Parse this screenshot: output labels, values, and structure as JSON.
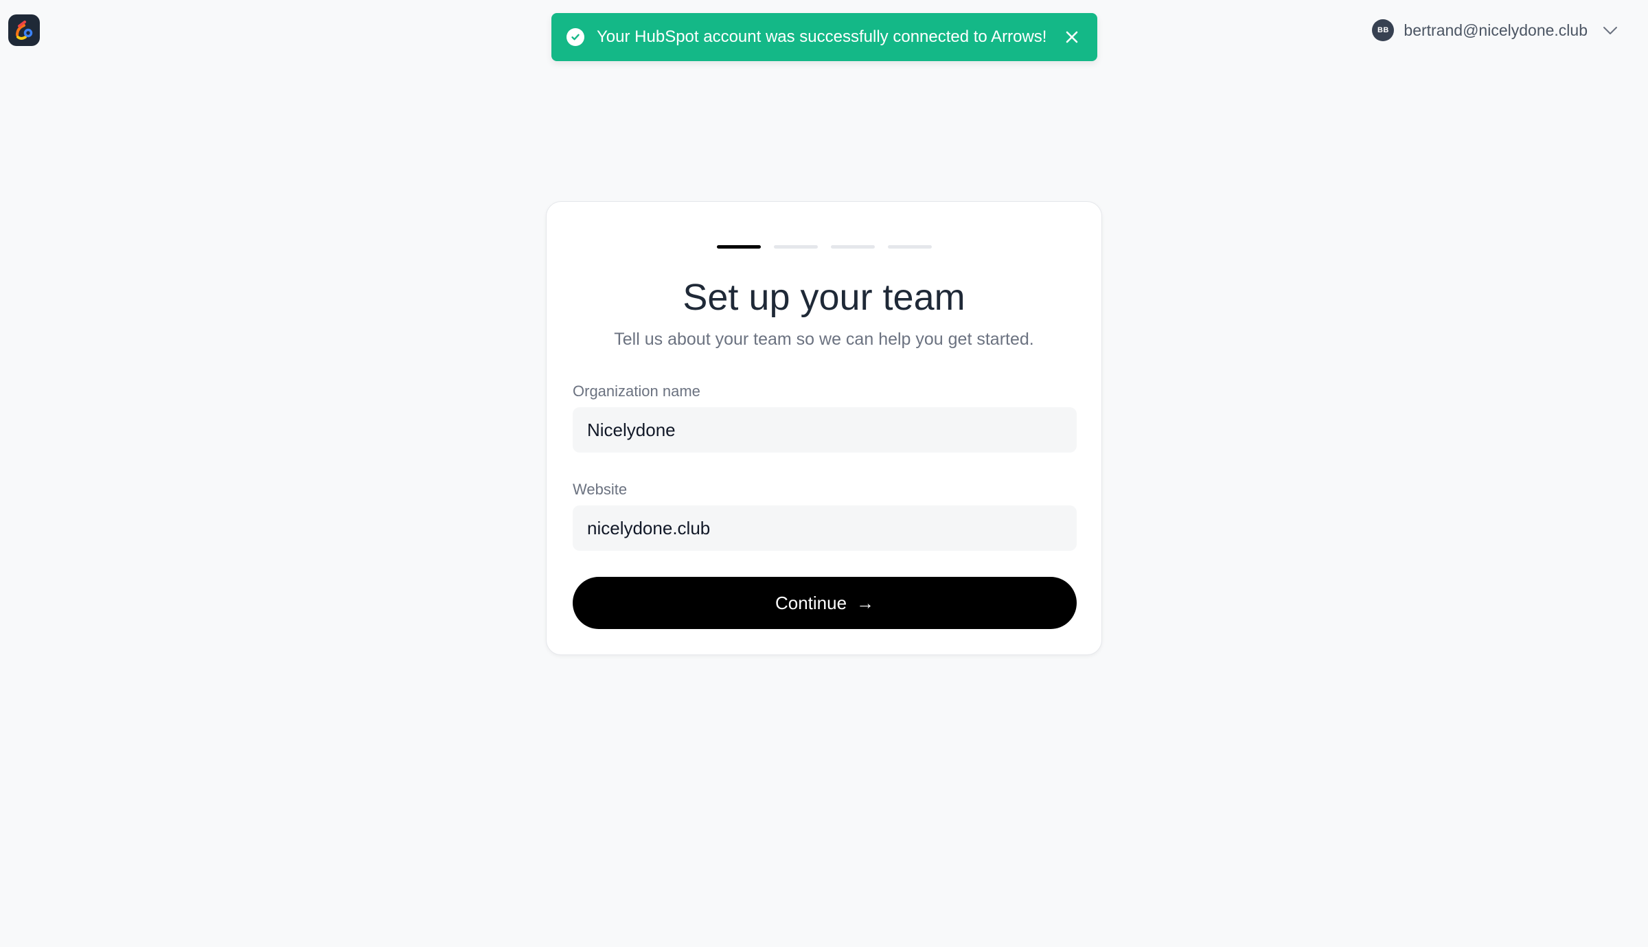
{
  "app": {
    "logo_icon": "arrows-app-logo-icon"
  },
  "toast": {
    "message": "Your HubSpot account was successfully connected to Arrows!",
    "status_icon": "check-circle-icon",
    "close_icon": "close-icon",
    "background_color": "#14b887"
  },
  "user_menu": {
    "avatar_initials": "BB",
    "email": "bertrand@nicelydone.club",
    "dropdown_icon": "chevron-down-icon"
  },
  "onboarding": {
    "steps_total": 4,
    "current_step": 1,
    "title": "Set up your team",
    "subtitle": "Tell us about your team so we can help you get started.",
    "fields": [
      {
        "label": "Organization name",
        "value": "Nicelydone"
      },
      {
        "label": "Website",
        "value": "nicelydone.club"
      }
    ],
    "continue_label": "Continue",
    "continue_arrow": "→"
  }
}
